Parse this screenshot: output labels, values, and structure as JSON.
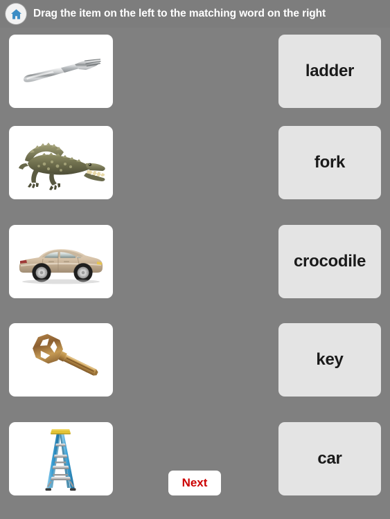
{
  "header": {
    "home_icon": "home-icon",
    "title": "Drag the item on the left to the matching word on the right"
  },
  "colors": {
    "background": "#808080",
    "header_bar": "#7d7d7d",
    "picture_card": "#ffffff",
    "word_card": "#e4e4e4",
    "word_text": "#1a1a1a",
    "title_text": "#ffffff",
    "next_button_bg": "#ffffff",
    "next_button_text": "#cc0000",
    "home_icon_fill": "#3c8dc5"
  },
  "pictures": [
    {
      "name": "fork",
      "icon": "fork-image"
    },
    {
      "name": "crocodile",
      "icon": "crocodile-image"
    },
    {
      "name": "car",
      "icon": "car-image"
    },
    {
      "name": "key",
      "icon": "key-image"
    },
    {
      "name": "ladder",
      "icon": "ladder-image"
    }
  ],
  "words": [
    {
      "label": "ladder"
    },
    {
      "label": "fork"
    },
    {
      "label": "crocodile"
    },
    {
      "label": "key"
    },
    {
      "label": "car"
    }
  ],
  "controls": {
    "next_label": "Next"
  }
}
